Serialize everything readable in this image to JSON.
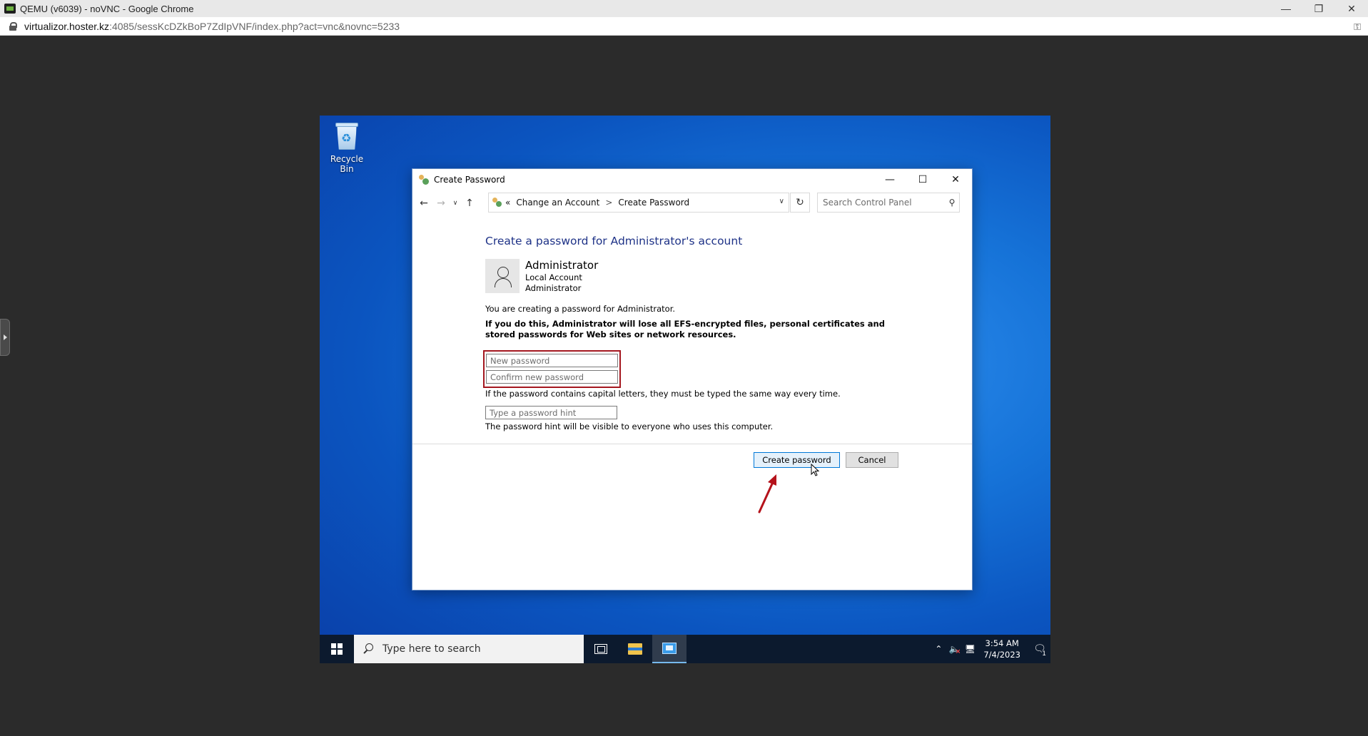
{
  "browser": {
    "title": "QEMU (v6039) - noVNC - Google Chrome",
    "url_host": "virtualizor.hoster.kz",
    "url_path": ":4085/sessKcDZkBoP7ZdIpVNF/index.php?act=vnc&novnc=5233"
  },
  "desktop": {
    "recycle_bin_label": "Recycle Bin"
  },
  "dialog": {
    "title": "Create Password",
    "breadcrumb": {
      "overflow": "«",
      "items": [
        "Change an Account",
        "Create Password"
      ],
      "separator": ">"
    },
    "search_placeholder": "Search Control Panel",
    "heading": "Create a password for Administrator's account",
    "account": {
      "name": "Administrator",
      "type": "Local Account",
      "role": "Administrator"
    },
    "creating_text": "You are creating a password for Administrator.",
    "warning_text": "If you do this, Administrator will lose all EFS-encrypted files, personal certificates and stored passwords for Web sites or network resources.",
    "new_password_placeholder": "New password",
    "confirm_password_placeholder": "Confirm new password",
    "caps_note": "If the password contains capital letters, they must be typed the same way every time.",
    "hint_placeholder": "Type a password hint",
    "hint_note": "The password hint will be visible to everyone who uses this computer.",
    "create_button": "Create password",
    "cancel_button": "Cancel"
  },
  "taskbar": {
    "search_text": "Type here to search",
    "time": "3:54 AM",
    "date": "7/4/2023",
    "notification_count": "1"
  },
  "colors": {
    "highlight_border": "#a4171f",
    "heading_blue": "#1e3287",
    "desktop_blue": "#1673d8"
  }
}
